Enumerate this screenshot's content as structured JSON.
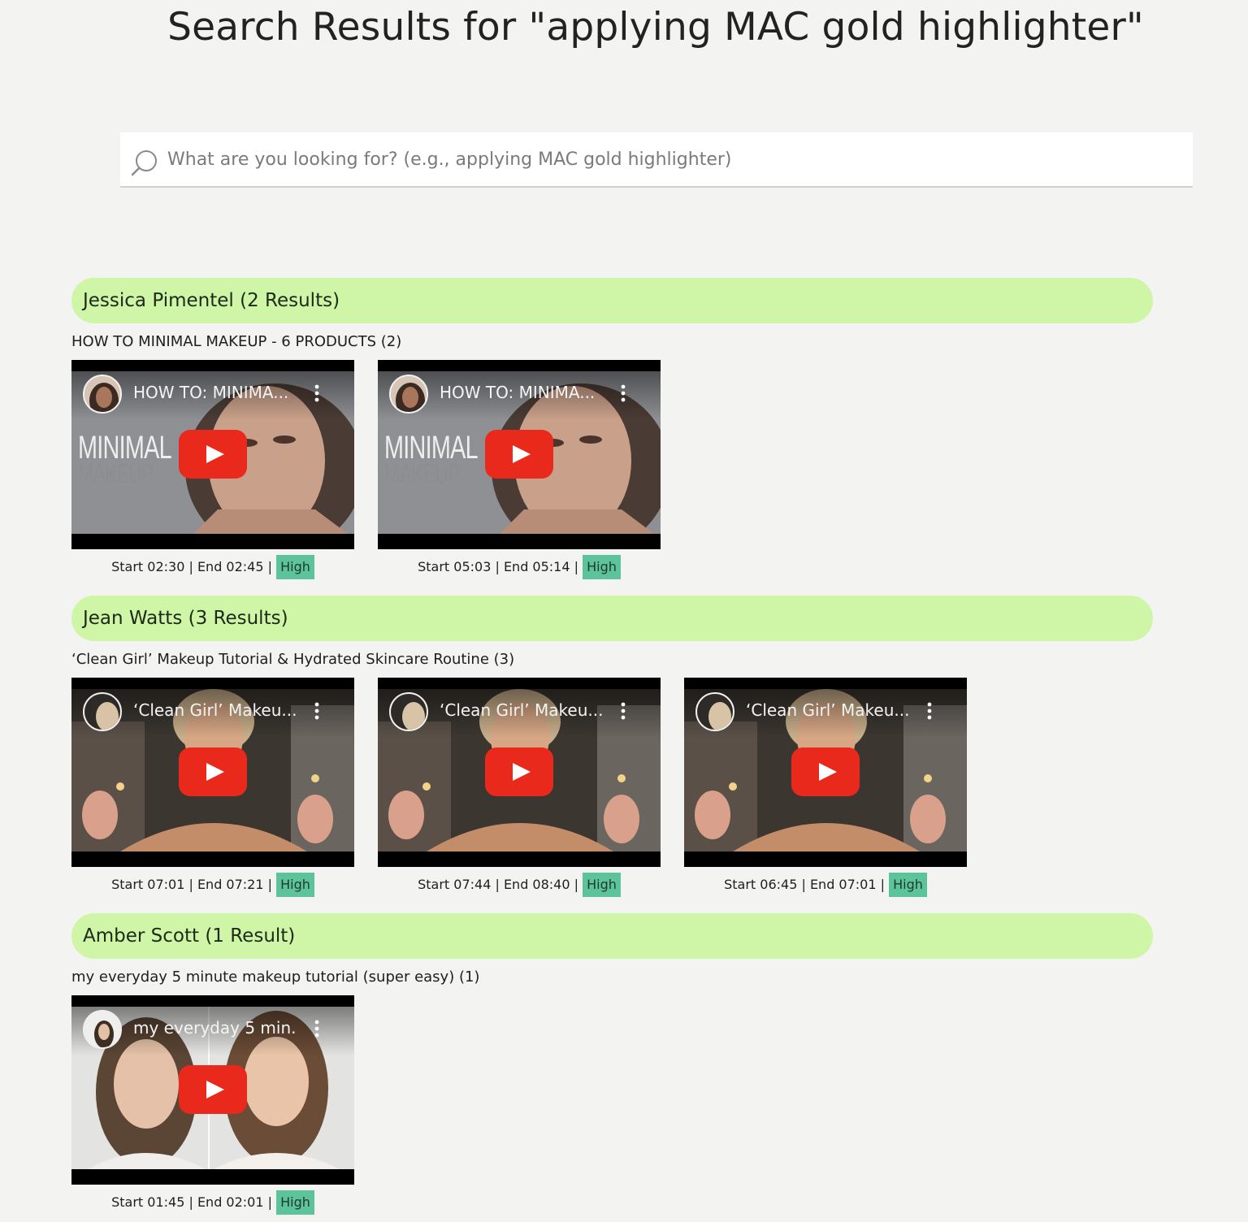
{
  "page": {
    "title": "Search Results for \"applying MAC gold highlighter\""
  },
  "search": {
    "placeholder": "What are you looking for? (e.g., applying MAC gold highlighter)",
    "value": ""
  },
  "colors": {
    "background": "#f3f3f1",
    "group_header": "#cff5a6",
    "badge": "#5cc39b",
    "play_button": "#e8291c"
  },
  "groups": [
    {
      "header": "Jessica Pimentel (2 Results)",
      "video_title": "HOW TO MINIMAL MAKEUP - 6 PRODUCTS (2)",
      "thumb_style": "minimal",
      "clips": [
        {
          "thumb_title": "HOW TO: MINIMA...",
          "thumb_overlay_1": "MINIMAL",
          "thumb_overlay_2": "MAKEUP",
          "range": "Start 02:30 | End 02:45 |",
          "badge": "High"
        },
        {
          "thumb_title": "HOW TO: MINIMA...",
          "thumb_overlay_1": "MINIMAL",
          "thumb_overlay_2": "MAKEUP",
          "range": "Start 05:03 | End 05:14 |",
          "badge": "High"
        }
      ]
    },
    {
      "header": "Jean Watts (3 Results)",
      "video_title": "‘Clean Girl’ Makeup Tutorial & Hydrated Skincare Routine (3)",
      "thumb_style": "cleangirl",
      "clips": [
        {
          "thumb_title": "‘Clean Girl’ Makeu...",
          "range": "Start 07:01 | End 07:21 |",
          "badge": "High"
        },
        {
          "thumb_title": "‘Clean Girl’ Makeu...",
          "range": "Start 07:44 | End 08:40 |",
          "badge": "High"
        },
        {
          "thumb_title": "‘Clean Girl’ Makeu...",
          "range": "Start 06:45 | End 07:01 |",
          "badge": "High"
        }
      ]
    },
    {
      "header": "Amber Scott (1 Result)",
      "video_title": "my everyday 5 minute makeup tutorial (super easy) (1)",
      "thumb_style": "everyday",
      "clips": [
        {
          "thumb_title": "my everyday 5 min...",
          "range": "Start 01:45 | End 02:01 |",
          "badge": "High"
        }
      ]
    }
  ]
}
